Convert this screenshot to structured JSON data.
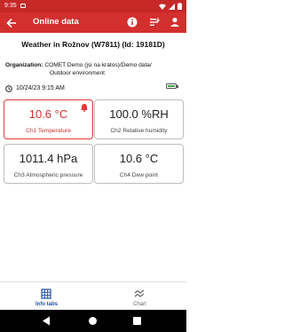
{
  "status_bar": {
    "time": "9:35"
  },
  "app_bar": {
    "title": "Online data"
  },
  "station": {
    "title": "Weather in Rožnov (W7811) (Id: 19181D)"
  },
  "organization": {
    "label": "Organization:",
    "line1": "COMET Demo (jsi na kratos)/Demo data/",
    "line2": "Outdoor environment"
  },
  "timestamp": "10/24/23 9:15 AM",
  "tiles": [
    {
      "value": "10.6 °C",
      "name": "Ch1 Temperature",
      "alarm": true
    },
    {
      "value": "100.0 %RH",
      "name": "Ch2 Relative humidity",
      "alarm": false
    },
    {
      "value": "1011.4 hPa",
      "name": "Ch3 Atmospheric pressure",
      "alarm": false
    },
    {
      "value": "10.6 °C",
      "name": "Ch4 Dew point",
      "alarm": false
    }
  ],
  "bottom_nav": [
    {
      "label": "Info tabs",
      "active": true,
      "icon": "grid-icon"
    },
    {
      "label": "Chart",
      "active": false,
      "icon": "chart-icon"
    }
  ],
  "colors": {
    "primary": "#d32f2f",
    "status_bar": "#c62828",
    "active_nav": "#1e4fa6",
    "alarm": "#e53935",
    "battery": "#43a047"
  }
}
